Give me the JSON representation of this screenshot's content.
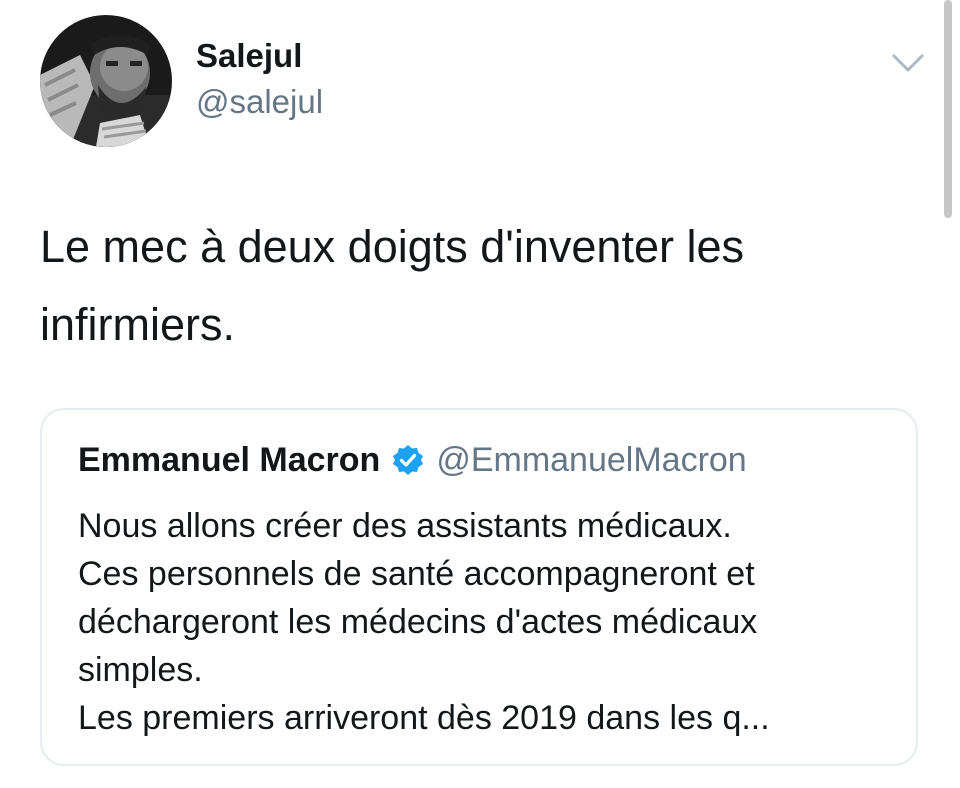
{
  "author": {
    "display_name": "Salejul",
    "handle": "@salejul",
    "avatar_icon": "profile-photo"
  },
  "menu_icon": "chevron-down-icon",
  "tweet": {
    "text": "Le mec à deux doigts d'inventer les\ninfirmiers."
  },
  "quoted_tweet": {
    "display_name": "Emmanuel Macron",
    "verified": true,
    "verified_icon": "verified-badge-icon",
    "handle": "@EmmanuelMacron",
    "lines": [
      "Nous allons créer des assistants médicaux.",
      "Ces personnels de santé accompagneront et",
      "déchargeront les médecins d'actes médicaux",
      "simples.",
      "Les premiers arriveront dès 2019 dans les q..."
    ]
  },
  "colors": {
    "text_primary": "#14171a",
    "text_secondary": "#657786",
    "verified_blue": "#1da1f2",
    "card_border": "#e6ecf0"
  }
}
